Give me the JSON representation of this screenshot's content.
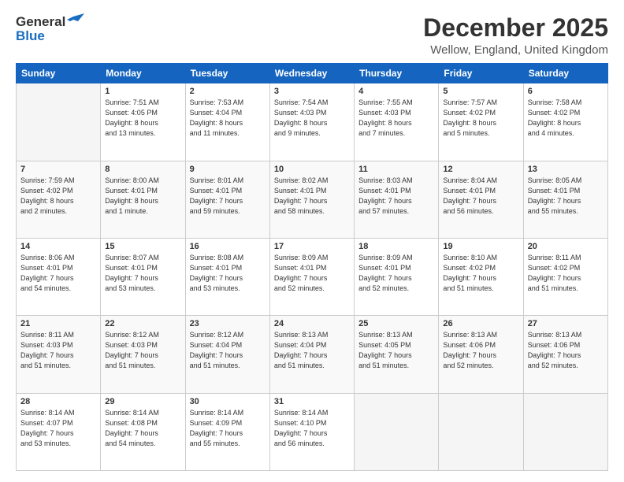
{
  "header": {
    "logo": {
      "general": "General",
      "blue": "Blue",
      "bird_unicode": "🔵"
    },
    "title": "December 2025",
    "subtitle": "Wellow, England, United Kingdom"
  },
  "calendar": {
    "days_of_week": [
      "Sunday",
      "Monday",
      "Tuesday",
      "Wednesday",
      "Thursday",
      "Friday",
      "Saturday"
    ],
    "weeks": [
      [
        {
          "day": "",
          "info": ""
        },
        {
          "day": "1",
          "info": "Sunrise: 7:51 AM\nSunset: 4:05 PM\nDaylight: 8 hours\nand 13 minutes."
        },
        {
          "day": "2",
          "info": "Sunrise: 7:53 AM\nSunset: 4:04 PM\nDaylight: 8 hours\nand 11 minutes."
        },
        {
          "day": "3",
          "info": "Sunrise: 7:54 AM\nSunset: 4:03 PM\nDaylight: 8 hours\nand 9 minutes."
        },
        {
          "day": "4",
          "info": "Sunrise: 7:55 AM\nSunset: 4:03 PM\nDaylight: 8 hours\nand 7 minutes."
        },
        {
          "day": "5",
          "info": "Sunrise: 7:57 AM\nSunset: 4:02 PM\nDaylight: 8 hours\nand 5 minutes."
        },
        {
          "day": "6",
          "info": "Sunrise: 7:58 AM\nSunset: 4:02 PM\nDaylight: 8 hours\nand 4 minutes."
        }
      ],
      [
        {
          "day": "7",
          "info": "Sunrise: 7:59 AM\nSunset: 4:02 PM\nDaylight: 8 hours\nand 2 minutes."
        },
        {
          "day": "8",
          "info": "Sunrise: 8:00 AM\nSunset: 4:01 PM\nDaylight: 8 hours\nand 1 minute."
        },
        {
          "day": "9",
          "info": "Sunrise: 8:01 AM\nSunset: 4:01 PM\nDaylight: 7 hours\nand 59 minutes."
        },
        {
          "day": "10",
          "info": "Sunrise: 8:02 AM\nSunset: 4:01 PM\nDaylight: 7 hours\nand 58 minutes."
        },
        {
          "day": "11",
          "info": "Sunrise: 8:03 AM\nSunset: 4:01 PM\nDaylight: 7 hours\nand 57 minutes."
        },
        {
          "day": "12",
          "info": "Sunrise: 8:04 AM\nSunset: 4:01 PM\nDaylight: 7 hours\nand 56 minutes."
        },
        {
          "day": "13",
          "info": "Sunrise: 8:05 AM\nSunset: 4:01 PM\nDaylight: 7 hours\nand 55 minutes."
        }
      ],
      [
        {
          "day": "14",
          "info": "Sunrise: 8:06 AM\nSunset: 4:01 PM\nDaylight: 7 hours\nand 54 minutes."
        },
        {
          "day": "15",
          "info": "Sunrise: 8:07 AM\nSunset: 4:01 PM\nDaylight: 7 hours\nand 53 minutes."
        },
        {
          "day": "16",
          "info": "Sunrise: 8:08 AM\nSunset: 4:01 PM\nDaylight: 7 hours\nand 53 minutes."
        },
        {
          "day": "17",
          "info": "Sunrise: 8:09 AM\nSunset: 4:01 PM\nDaylight: 7 hours\nand 52 minutes."
        },
        {
          "day": "18",
          "info": "Sunrise: 8:09 AM\nSunset: 4:01 PM\nDaylight: 7 hours\nand 52 minutes."
        },
        {
          "day": "19",
          "info": "Sunrise: 8:10 AM\nSunset: 4:02 PM\nDaylight: 7 hours\nand 51 minutes."
        },
        {
          "day": "20",
          "info": "Sunrise: 8:11 AM\nSunset: 4:02 PM\nDaylight: 7 hours\nand 51 minutes."
        }
      ],
      [
        {
          "day": "21",
          "info": "Sunrise: 8:11 AM\nSunset: 4:03 PM\nDaylight: 7 hours\nand 51 minutes."
        },
        {
          "day": "22",
          "info": "Sunrise: 8:12 AM\nSunset: 4:03 PM\nDaylight: 7 hours\nand 51 minutes."
        },
        {
          "day": "23",
          "info": "Sunrise: 8:12 AM\nSunset: 4:04 PM\nDaylight: 7 hours\nand 51 minutes."
        },
        {
          "day": "24",
          "info": "Sunrise: 8:13 AM\nSunset: 4:04 PM\nDaylight: 7 hours\nand 51 minutes."
        },
        {
          "day": "25",
          "info": "Sunrise: 8:13 AM\nSunset: 4:05 PM\nDaylight: 7 hours\nand 51 minutes."
        },
        {
          "day": "26",
          "info": "Sunrise: 8:13 AM\nSunset: 4:06 PM\nDaylight: 7 hours\nand 52 minutes."
        },
        {
          "day": "27",
          "info": "Sunrise: 8:13 AM\nSunset: 4:06 PM\nDaylight: 7 hours\nand 52 minutes."
        }
      ],
      [
        {
          "day": "28",
          "info": "Sunrise: 8:14 AM\nSunset: 4:07 PM\nDaylight: 7 hours\nand 53 minutes."
        },
        {
          "day": "29",
          "info": "Sunrise: 8:14 AM\nSunset: 4:08 PM\nDaylight: 7 hours\nand 54 minutes."
        },
        {
          "day": "30",
          "info": "Sunrise: 8:14 AM\nSunset: 4:09 PM\nDaylight: 7 hours\nand 55 minutes."
        },
        {
          "day": "31",
          "info": "Sunrise: 8:14 AM\nSunset: 4:10 PM\nDaylight: 7 hours\nand 56 minutes."
        },
        {
          "day": "",
          "info": ""
        },
        {
          "day": "",
          "info": ""
        },
        {
          "day": "",
          "info": ""
        }
      ]
    ]
  }
}
